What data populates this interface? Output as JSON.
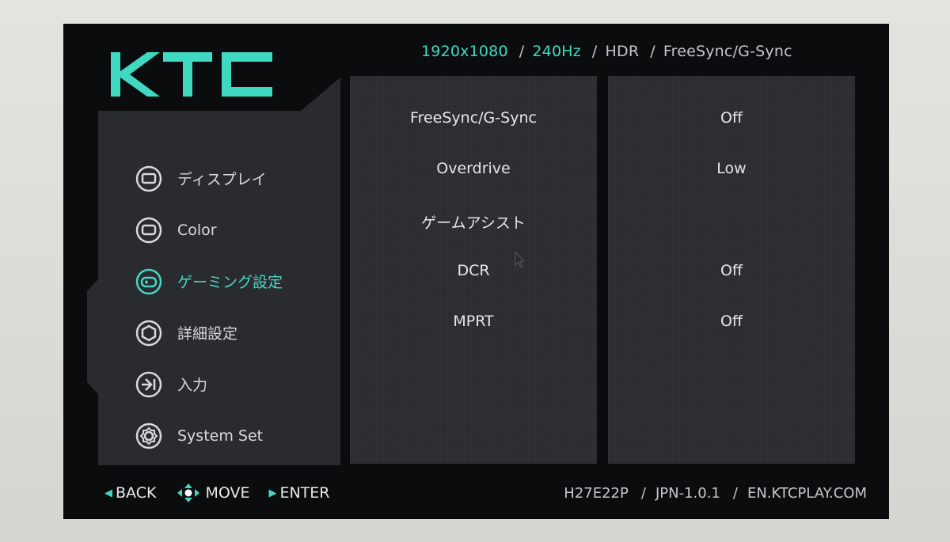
{
  "status_bar": {
    "resolution": "1920x1080",
    "refresh": "240Hz",
    "hdr": "HDR",
    "sync": "FreeSync/G-Sync",
    "separator": "/"
  },
  "logo": {
    "text": "KTC"
  },
  "menu": {
    "items": [
      {
        "label": "ディスプレイ",
        "icon": "display-icon",
        "active": false
      },
      {
        "label": "Color",
        "icon": "color-icon",
        "active": false
      },
      {
        "label": "ゲーミング設定",
        "icon": "gamepad-icon",
        "active": true
      },
      {
        "label": "詳細設定",
        "icon": "advanced-settings-icon",
        "active": false
      },
      {
        "label": "入力",
        "icon": "input-icon",
        "active": false
      },
      {
        "label": "System Set",
        "icon": "system-gear-icon",
        "active": false
      }
    ]
  },
  "settings": [
    {
      "name": "FreeSync/G-Sync",
      "value": "Off"
    },
    {
      "name": "Overdrive",
      "value": "Low"
    },
    {
      "name": "ゲームアシスト",
      "value": ""
    },
    {
      "name": "DCR",
      "value": "Off"
    },
    {
      "name": "MPRT",
      "value": "Off"
    }
  ],
  "footer": {
    "back": "BACK",
    "move": "MOVE",
    "enter": "ENTER",
    "model": "H27E22P",
    "firmware": "JPN-1.0.1",
    "website": "EN.KTCPLAY.COM",
    "separator": "/"
  },
  "colors": {
    "accent": "#3fd9c2",
    "background": "#0b0c0e",
    "panel": "#2a2b2f"
  }
}
